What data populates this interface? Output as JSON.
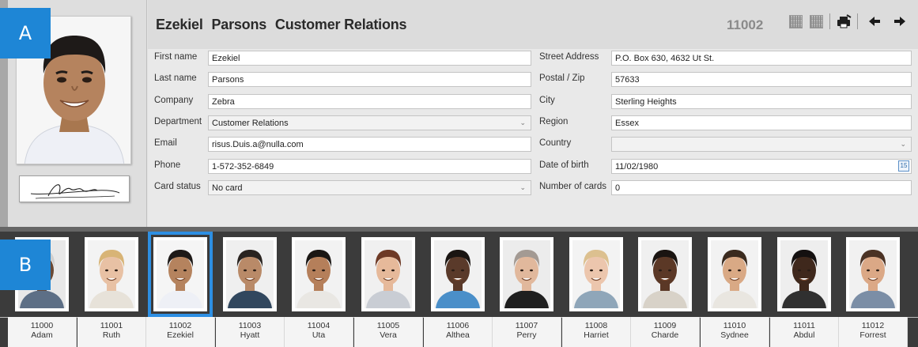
{
  "badges": {
    "a": "A",
    "b": "B"
  },
  "header": {
    "title_first": "Ezekiel",
    "title_last": "Parsons",
    "title_dept": "Customer Relations",
    "record_id": "11002"
  },
  "toolbar": {
    "icons": [
      "qr-code-icon",
      "qr-code-icon",
      "printer-icon",
      "arrow-left-icon",
      "arrow-right-icon"
    ]
  },
  "form": {
    "left": [
      {
        "label": "First name",
        "value": "Ezekiel",
        "type": "text"
      },
      {
        "label": "Last name",
        "value": "Parsons",
        "type": "text"
      },
      {
        "label": "Company",
        "value": "Zebra",
        "type": "text"
      },
      {
        "label": "Department",
        "value": "Customer Relations",
        "type": "select"
      },
      {
        "label": "Email",
        "value": "risus.Duis.a@nulla.com",
        "type": "text"
      },
      {
        "label": "Phone",
        "value": "1-572-352-6849",
        "type": "text"
      },
      {
        "label": "Card status",
        "value": "No card",
        "type": "select"
      }
    ],
    "right": [
      {
        "label": "Street Address",
        "value": "P.O. Box 630, 4632 Ut St.",
        "type": "text"
      },
      {
        "label": "Postal / Zip",
        "value": "57633",
        "type": "text"
      },
      {
        "label": "City",
        "value": "Sterling Heights",
        "type": "text"
      },
      {
        "label": "Region",
        "value": "Essex",
        "type": "text"
      },
      {
        "label": "Country",
        "value": "",
        "type": "select"
      },
      {
        "label": "Date of birth",
        "value": "11/02/1980",
        "type": "date"
      },
      {
        "label": "Number of cards",
        "value": "0",
        "type": "text"
      }
    ],
    "calendar_glyph": "15"
  },
  "people": [
    {
      "id": "11000",
      "name": "Adam",
      "skin": "#6b4a36",
      "hair": "#cfcfcf",
      "shirt": "#5d6f86",
      "bg": "#e8e8e8"
    },
    {
      "id": "11001",
      "name": "Ruth",
      "skin": "#e8c1a4",
      "hair": "#d8b476",
      "shirt": "#e7e2d9",
      "bg": "#f3f3f3"
    },
    {
      "id": "11002",
      "name": "Ezekiel",
      "skin": "#b5835e",
      "hair": "#1e1a18",
      "shirt": "#eef0f6",
      "bg": "#f5f5f5"
    },
    {
      "id": "11003",
      "name": "Hyatt",
      "skin": "#b98a68",
      "hair": "#2a2420",
      "shirt": "#31475e",
      "bg": "#efefef"
    },
    {
      "id": "11004",
      "name": "Uta",
      "skin": "#b57f5a",
      "hair": "#1b1714",
      "shirt": "#e9e7e3",
      "bg": "#f2f2f2"
    },
    {
      "id": "11005",
      "name": "Vera",
      "skin": "#e6b99a",
      "hair": "#6e3a26",
      "shirt": "#c9cdd4",
      "bg": "#f0f0f0"
    },
    {
      "id": "11006",
      "name": "Althea",
      "skin": "#5a3a2a",
      "hair": "#1a1512",
      "shirt": "#4a8fc9",
      "bg": "#f1f1f1"
    },
    {
      "id": "11007",
      "name": "Perry",
      "skin": "#e1b89c",
      "hair": "#a39a93",
      "shirt": "#1f1f1f",
      "bg": "#ececec"
    },
    {
      "id": "11008",
      "name": "Harriet",
      "skin": "#ecc6ad",
      "hair": "#dcc08f",
      "shirt": "#8fa6b9",
      "bg": "#f3f3f3"
    },
    {
      "id": "11009",
      "name": "Charde",
      "skin": "#5b3826",
      "hair": "#1a1411",
      "shirt": "#d8d2c8",
      "bg": "#f0f0f0"
    },
    {
      "id": "11010",
      "name": "Sydnee",
      "skin": "#d9a985",
      "hair": "#3a2a1e",
      "shirt": "#e9e6e0",
      "bg": "#f2f2f2"
    },
    {
      "id": "11011",
      "name": "Abdul",
      "skin": "#3f281c",
      "hair": "#141010",
      "shirt": "#303030",
      "bg": "#eeeeee"
    },
    {
      "id": "11012",
      "name": "Forrest",
      "skin": "#dba886",
      "hair": "#4b3224",
      "shirt": "#7b8ea6",
      "bg": "#f1f1f1"
    }
  ],
  "selected_id": "11002"
}
